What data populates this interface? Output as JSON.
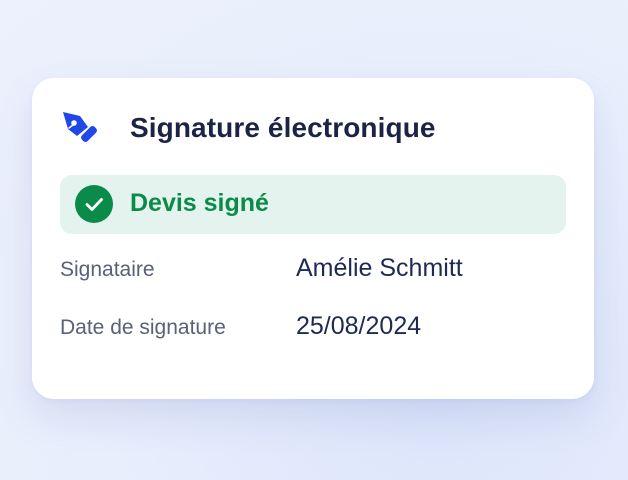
{
  "card": {
    "title": "Signature électronique",
    "icon": "signature-pen-icon",
    "status": {
      "label": "Devis signé",
      "icon": "check-circle-icon",
      "color": "#0b8b4a",
      "background": "#e4f3ee"
    },
    "rows": [
      {
        "label": "Signataire",
        "value": "Amélie Schmitt"
      },
      {
        "label": "Date de signature",
        "value": "25/08/2024"
      }
    ]
  },
  "colors": {
    "accent": "#1f48e6",
    "title": "#1b2446",
    "success": "#0b8b4a"
  }
}
